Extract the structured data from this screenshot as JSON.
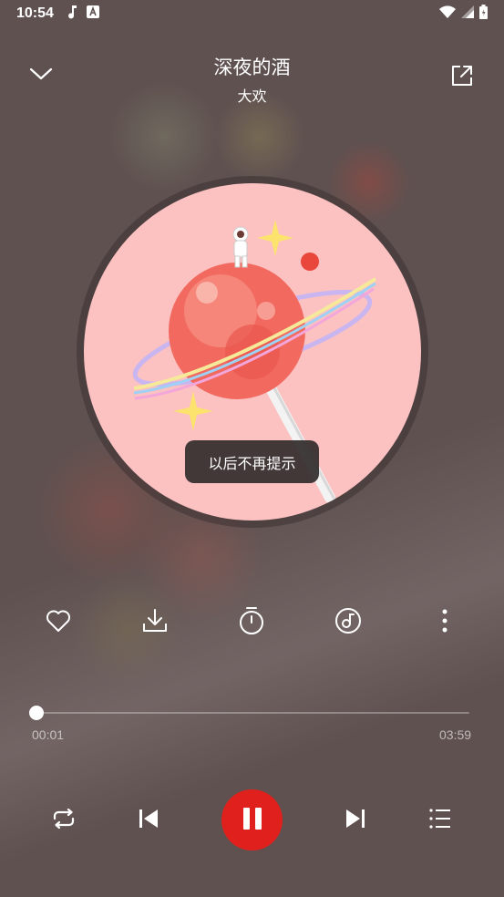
{
  "status_bar": {
    "time": "10:54",
    "icons": [
      "music-note-icon",
      "font-a-icon",
      "wifi-icon",
      "signal-icon",
      "battery-icon"
    ]
  },
  "header": {
    "title": "深夜的酒",
    "artist": "大欢",
    "collapse_icon": "chevron-down-icon",
    "share_icon": "external-link-icon"
  },
  "toast": {
    "text": "以后不再提示"
  },
  "actions": [
    {
      "name": "like",
      "icon": "heart-icon"
    },
    {
      "name": "download",
      "icon": "download-icon"
    },
    {
      "name": "timer",
      "icon": "timer-icon"
    },
    {
      "name": "sound-effect",
      "icon": "music-disc-icon"
    },
    {
      "name": "more",
      "icon": "more-vertical-icon"
    }
  ],
  "progress": {
    "current": "00:01",
    "total": "03:59",
    "fraction": 0.004
  },
  "controls": [
    {
      "name": "repeat",
      "icon": "repeat-icon"
    },
    {
      "name": "previous",
      "icon": "skip-previous-icon"
    },
    {
      "name": "play-pause",
      "icon": "pause-icon"
    },
    {
      "name": "next",
      "icon": "skip-next-icon"
    },
    {
      "name": "playlist",
      "icon": "playlist-icon"
    }
  ],
  "colors": {
    "background": "#5f5150",
    "accent": "#e0201c",
    "album_bg": "#fcc1c1"
  }
}
